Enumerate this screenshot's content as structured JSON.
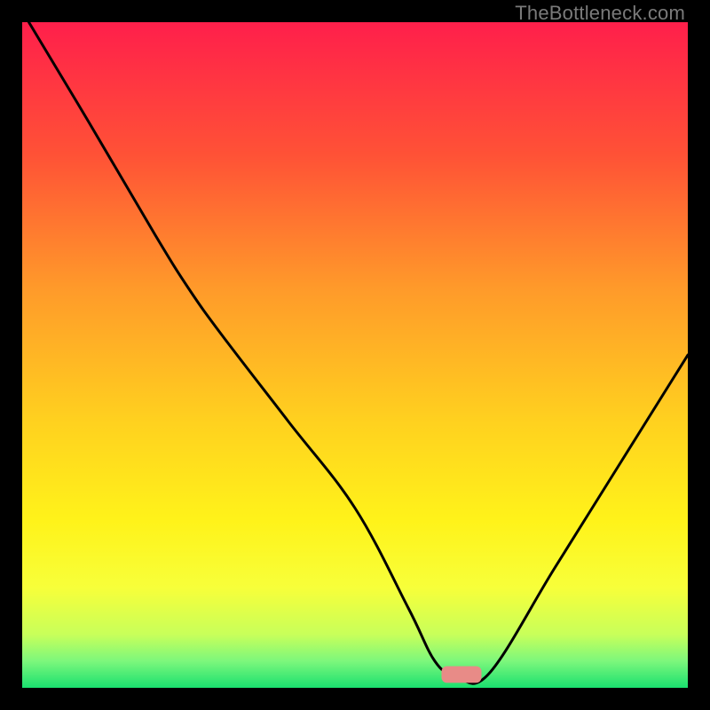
{
  "watermark": "TheBottleneck.com",
  "chart_data": {
    "type": "line",
    "title": "",
    "xlabel": "",
    "ylabel": "",
    "xlim": [
      0,
      100
    ],
    "ylim": [
      0,
      100
    ],
    "grid": false,
    "series": [
      {
        "name": "bottleneck-curve",
        "x": [
          1,
          10,
          20,
          25,
          30,
          40,
          50,
          58,
          62,
          65,
          70,
          80,
          90,
          100
        ],
        "y": [
          100,
          85,
          68,
          60,
          53,
          40,
          27,
          12,
          4,
          2,
          2,
          18,
          34,
          50
        ]
      }
    ],
    "optimal_marker": {
      "x": 66,
      "y": 2,
      "width": 6,
      "height": 2.5,
      "color": "#e88b87"
    },
    "gradient_stops": [
      {
        "offset": 0.0,
        "color": "#ff1f4b"
      },
      {
        "offset": 0.2,
        "color": "#ff5236"
      },
      {
        "offset": 0.4,
        "color": "#ff9a2a"
      },
      {
        "offset": 0.6,
        "color": "#ffd11f"
      },
      {
        "offset": 0.75,
        "color": "#fff31a"
      },
      {
        "offset": 0.85,
        "color": "#f7ff3a"
      },
      {
        "offset": 0.92,
        "color": "#c8ff5a"
      },
      {
        "offset": 0.96,
        "color": "#7cf77c"
      },
      {
        "offset": 1.0,
        "color": "#1ae06f"
      }
    ]
  }
}
